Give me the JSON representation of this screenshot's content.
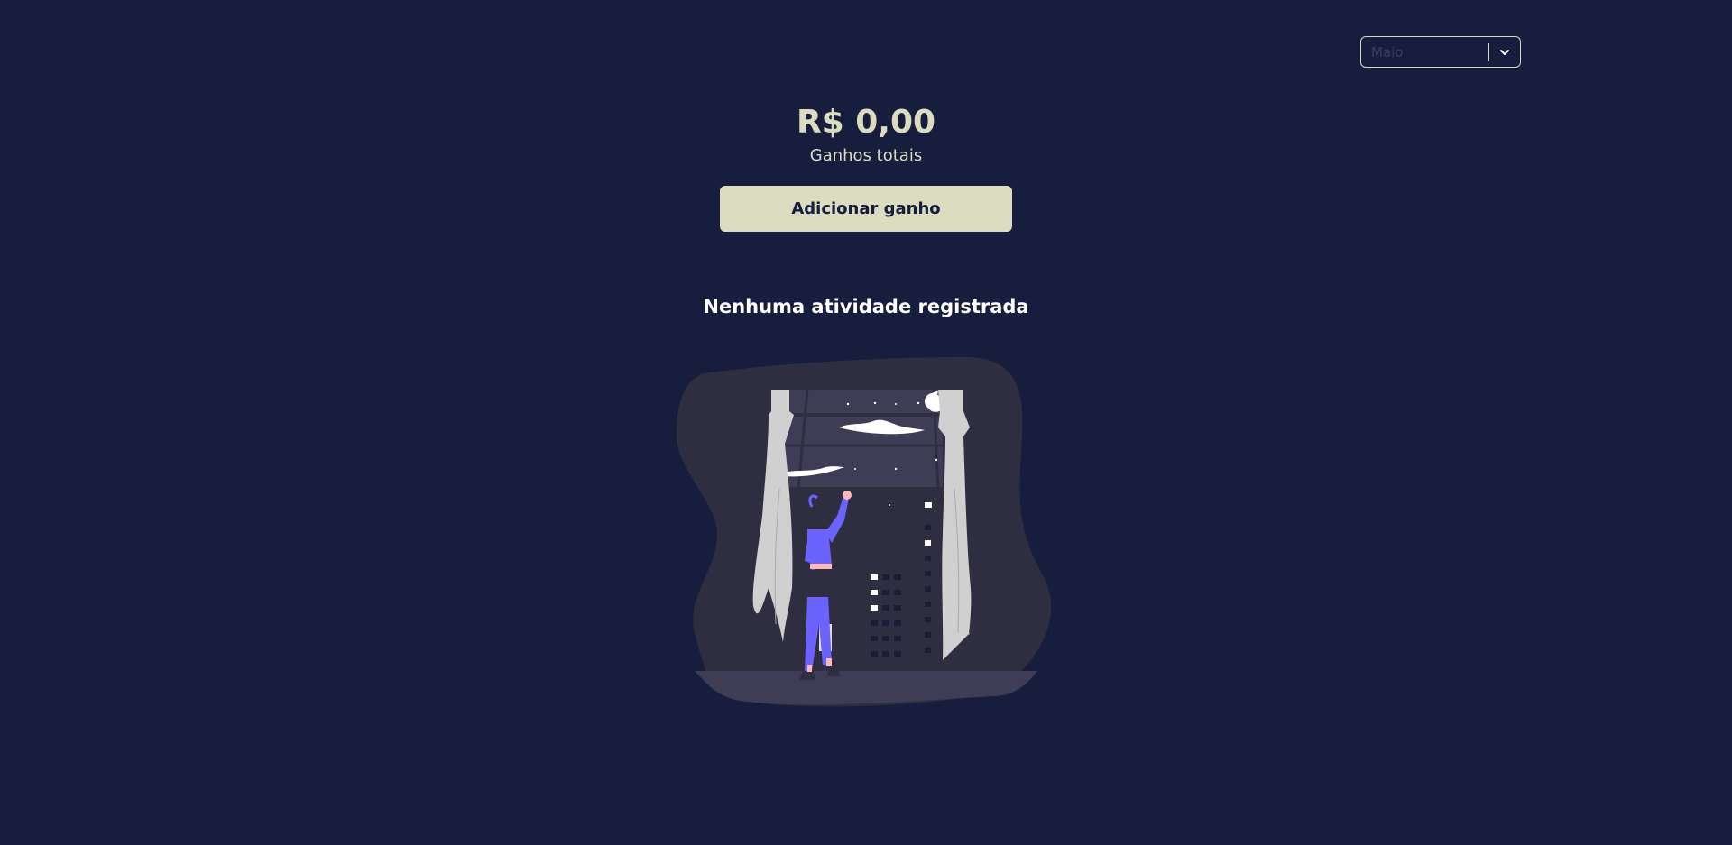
{
  "filter": {
    "month_value": "Maio"
  },
  "summary": {
    "total": "R$ 0,00",
    "label": "Ganhos totais"
  },
  "actions": {
    "add_label": "Adicionar ganho"
  },
  "empty_state": {
    "title": "Nenhuma atividade registrada"
  },
  "colors": {
    "background": "#161d3d",
    "accent": "#dcdcc0",
    "figure": "#6c63ff"
  },
  "icons": {
    "select": "chevron-down-icon"
  }
}
